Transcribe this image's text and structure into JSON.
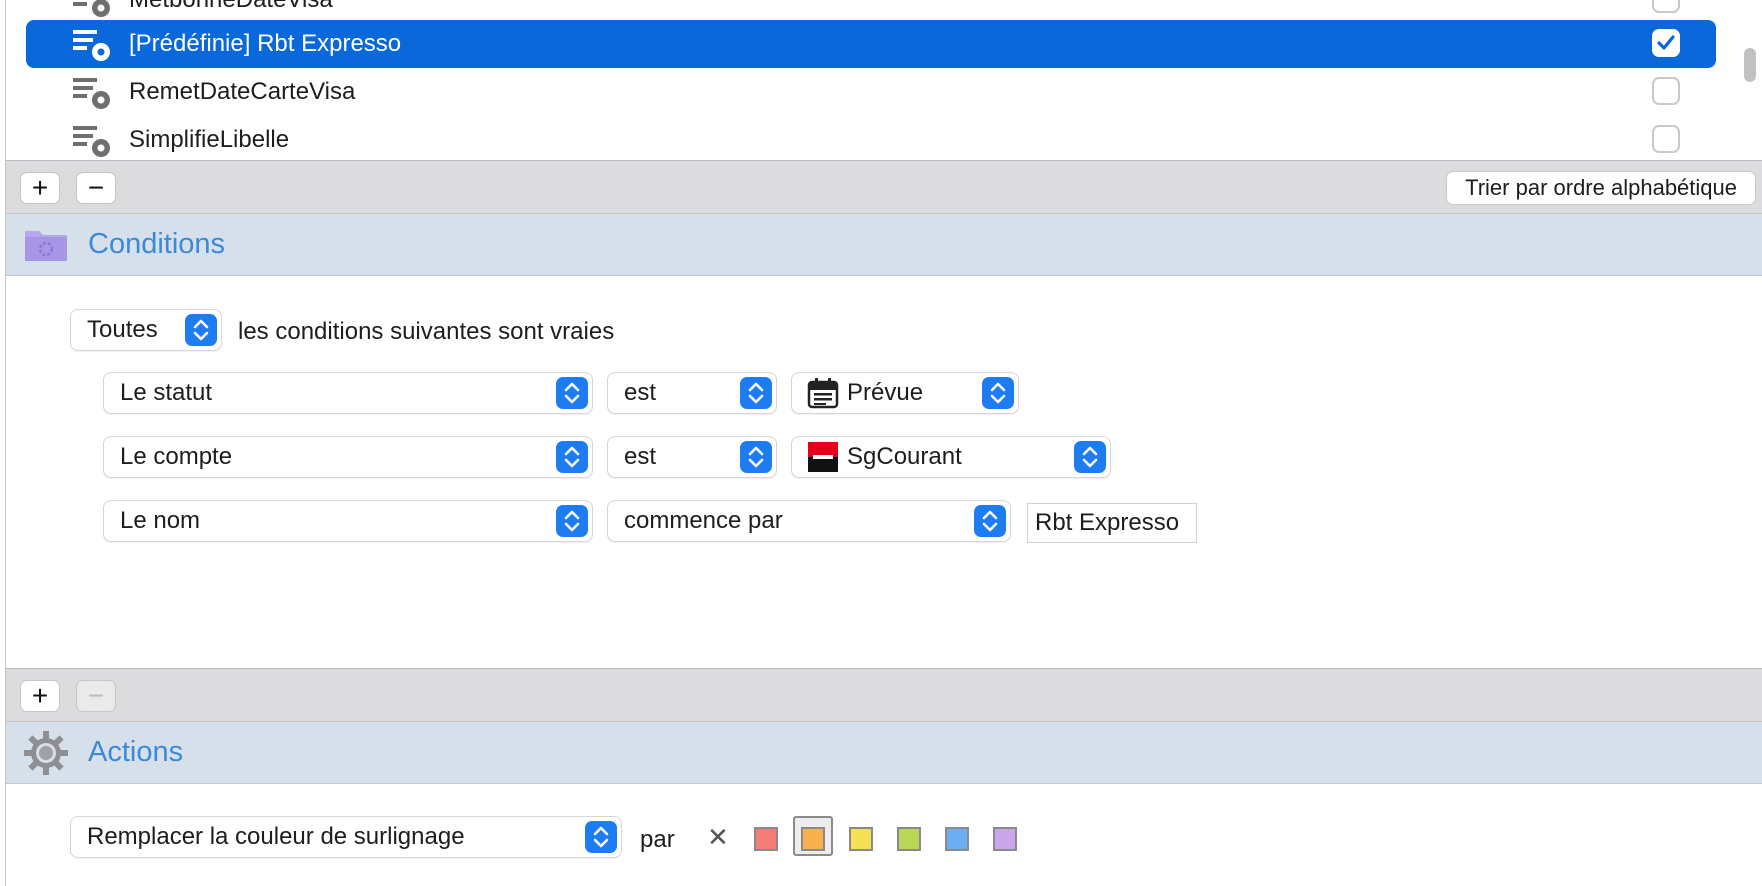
{
  "rules": [
    {
      "label": "MetbonneDateVisa",
      "checked": false,
      "selected": false
    },
    {
      "label": "[Prédéfinie] Rbt Expresso",
      "checked": true,
      "selected": true
    },
    {
      "label": "RemetDateCarteVisa",
      "checked": false,
      "selected": false
    },
    {
      "label": "SimplifieLibelle",
      "checked": false,
      "selected": false
    }
  ],
  "rules_toolbar": {
    "add": "+",
    "remove": "−",
    "sort_label": "Trier par ordre alphabétique"
  },
  "conditions": {
    "title": "Conditions",
    "match_mode": "Toutes",
    "match_suffix": "les conditions suivantes sont vraies",
    "rows": [
      {
        "field": "Le statut",
        "operator": "est",
        "value": "Prévue",
        "value_icon": "calendar-icon"
      },
      {
        "field": "Le compte",
        "operator": "est",
        "value": "SgCourant",
        "value_icon": "bank-logo-icon"
      },
      {
        "field": "Le nom",
        "operator": "commence par",
        "value": "Rbt Expresso"
      }
    ]
  },
  "conditions_toolbar": {
    "add": "+",
    "remove": "−"
  },
  "actions": {
    "title": "Actions",
    "action": "Remplacer la couleur de surlignage",
    "by_label": "par",
    "no_color": "✕",
    "colors": [
      "#f47c74",
      "#fbb04f",
      "#f4e253",
      "#b9d655",
      "#6aaef4",
      "#cca6ec"
    ],
    "selected_color_index": 1
  },
  "colors": {
    "accent": "#1d7cf2",
    "selection": "#0a68db",
    "section_bg": "#d5e0eb",
    "section_title": "#3c8ad6"
  }
}
